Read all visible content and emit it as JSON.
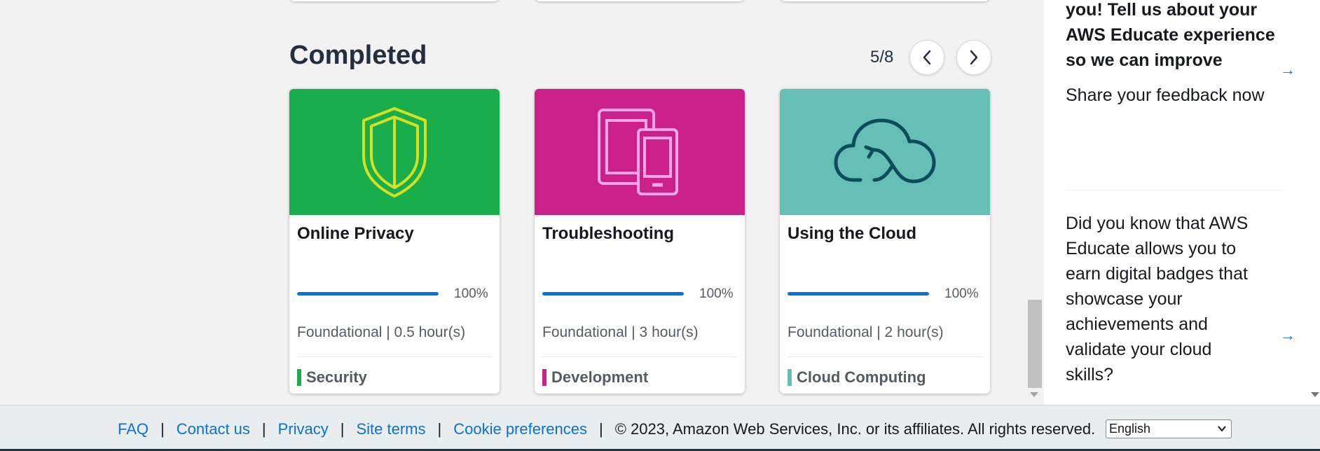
{
  "section": {
    "title": "Completed",
    "pager": {
      "count": "5/8"
    }
  },
  "cards": [
    {
      "title": "Online Privacy",
      "progress": 100,
      "progress_label": "100%",
      "meta": "Foundational | 0.5 hour(s)",
      "category": "Security",
      "image_color": "#1aad4b",
      "category_color": "#1aad4b",
      "icon": "shield-icon"
    },
    {
      "title": "Troubleshooting",
      "progress": 100,
      "progress_label": "100%",
      "meta": "Foundational | 3 hour(s)",
      "category": "Development",
      "image_color": "#cb1f8a",
      "category_color": "#cb1f8a",
      "icon": "devices-icon"
    },
    {
      "title": "Using the Cloud",
      "progress": 100,
      "progress_label": "100%",
      "meta": "Foundational | 2 hour(s)",
      "category": "Cloud Computing",
      "image_color": "#65bfb5",
      "category_color": "#65bfb5",
      "icon": "cloud-sync-icon"
    }
  ],
  "sidebar": {
    "item1_bold": "you! Tell us about your AWS Educate experience so we can improve",
    "item1_link": "Share your feedback now",
    "item2_text": "Did you know that AWS Educate allows you to earn digital badges that showcase your achievements and validate your cloud skills?"
  },
  "footer": {
    "links": [
      "FAQ",
      "Contact us",
      "Privacy",
      "Site terms",
      "Cookie preferences"
    ],
    "copyright": "© 2023, Amazon Web Services, Inc. or its affiliates. All rights reserved.",
    "language": "English"
  }
}
